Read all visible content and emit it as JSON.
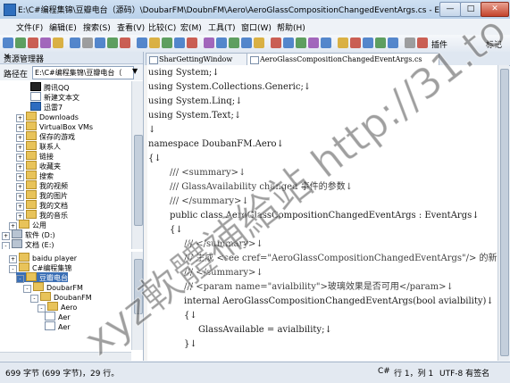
{
  "window": {
    "title": "E:\\C#编程集锦\\豆瓣电台（源码）\\DoubarFM\\DoubnFM\\Aero\\AeroGlassCompositionChangedEventArgs.cs - EmEditor",
    "minimize": "—",
    "maximize": "□",
    "close": "✕"
  },
  "menu": [
    "文件(F)",
    "编辑(E)",
    "搜索(S)",
    "查看(V)",
    "比较(C)",
    "宏(M)",
    "工具(T)",
    "窗口(W)",
    "帮助(H)"
  ],
  "toolbar": {
    "plugin_label": "插件",
    "bookmark_label": "标记",
    "colors": [
      "#2d6cc0",
      "#3a8a3a",
      "#c0392b",
      "#8e44ad",
      "#d4a017",
      "#2d6cc0",
      "#888888",
      "#2d6cc0",
      "#3a8a3a",
      "#c0392b",
      "#2d6cc0",
      "#d4a017",
      "#3a8a3a",
      "#2d6cc0",
      "#c0392b",
      "#8e44ad",
      "#2d6cc0",
      "#3a8a3a",
      "#2d6cc0",
      "#d4a017",
      "#c0392b",
      "#2d6cc0",
      "#3a8a3a",
      "#8e44ad",
      "#2d6cc0",
      "#d4a017",
      "#c0392b",
      "#2d6cc0",
      "#3a8a3a",
      "#2d6cc0",
      "#888888",
      "#c0392b",
      "#2d6cc0",
      "#3a8a3a",
      "#d4a017"
    ]
  },
  "explorer": {
    "title": "资源管理器",
    "close": "✕",
    "path_label": "路径在",
    "path_value": "E:\\C#编程集锦\\豆瓣电台（",
    "tree_top": [
      {
        "label": "腾讯QQ",
        "indent": 4,
        "icon": "qq"
      },
      {
        "label": "新建文本文",
        "indent": 4,
        "icon": "file"
      },
      {
        "label": "迅雷7",
        "indent": 4,
        "icon": "app"
      },
      {
        "label": "Downloads",
        "indent": 2,
        "icon": "folder",
        "pm": "+"
      },
      {
        "label": "VirtualBox VMs",
        "indent": 2,
        "icon": "folder",
        "pm": "+"
      },
      {
        "label": "保存的游戏",
        "indent": 2,
        "icon": "folder",
        "pm": "+"
      },
      {
        "label": "联系人",
        "indent": 2,
        "icon": "folder",
        "pm": "+"
      },
      {
        "label": "链接",
        "indent": 2,
        "icon": "folder",
        "pm": "+"
      },
      {
        "label": "收藏夹",
        "indent": 2,
        "icon": "folder",
        "pm": "+"
      },
      {
        "label": "搜索",
        "indent": 2,
        "icon": "folder",
        "pm": "+"
      },
      {
        "label": "我的视频",
        "indent": 2,
        "icon": "folder",
        "pm": "+"
      },
      {
        "label": "我的图片",
        "indent": 2,
        "icon": "folder",
        "pm": "+"
      },
      {
        "label": "我的文档",
        "indent": 2,
        "icon": "folder",
        "pm": "+"
      },
      {
        "label": "我的音乐",
        "indent": 2,
        "icon": "folder",
        "pm": "+"
      },
      {
        "label": "公用",
        "indent": 1,
        "icon": "folder",
        "pm": "+"
      },
      {
        "label": "软件 (D:)",
        "indent": 0,
        "icon": "drive",
        "pm": "+"
      },
      {
        "label": "文档 (E:)",
        "indent": 0,
        "icon": "drive",
        "pm": "-"
      }
    ],
    "tree_bottom": [
      {
        "label": "baidu player",
        "indent": 1,
        "icon": "folder",
        "pm": "+"
      },
      {
        "label": "C#编程集锦",
        "indent": 1,
        "icon": "folder",
        "pm": "-"
      },
      {
        "label": "豆瓣电台",
        "indent": 2,
        "icon": "folder",
        "pm": "-",
        "selected": true
      },
      {
        "label": "DoubarFM",
        "indent": 3,
        "icon": "folder",
        "pm": "-"
      },
      {
        "label": "DoubanFM",
        "indent": 4,
        "icon": "folder",
        "pm": "-"
      },
      {
        "label": "Aero",
        "indent": 5,
        "icon": "folder",
        "pm": "-"
      },
      {
        "label": "Aer",
        "indent": 6,
        "icon": "file"
      },
      {
        "label": "Aer",
        "indent": 6,
        "icon": "file"
      }
    ]
  },
  "tabs": [
    {
      "label": "SharGettingWindow",
      "active": false
    },
    {
      "label": "AeroGlassCompositionChangedEventArgs.cs",
      "active": true
    }
  ],
  "code": [
    {
      "text": "using System;↓",
      "indent": 0
    },
    {
      "text": "using System.Collections.Generic;↓",
      "indent": 0
    },
    {
      "text": "using System.Linq;↓",
      "indent": 0
    },
    {
      "text": "using System.Text;↓",
      "indent": 0
    },
    {
      "text": "↓",
      "indent": 0
    },
    {
      "text": "namespace DoubanFM.Aero↓",
      "indent": 0
    },
    {
      "text": "{↓",
      "indent": 0
    },
    {
      "text": "/// <summary>↓",
      "indent": 3,
      "comment": true
    },
    {
      "text": "/// GlassAvailability changed 事件的参数↓",
      "indent": 3,
      "comment": true
    },
    {
      "text": "/// </summary>↓",
      "indent": 3,
      "comment": true
    },
    {
      "text": "public class AeroGlassCompositionChangedEventArgs : EventArgs↓",
      "indent": 3
    },
    {
      "text": "{↓",
      "indent": 3
    },
    {
      "text": "/// </summary>↓",
      "indent": 5,
      "comment": true
    },
    {
      "text": "/// 生成 <see cref=\"AeroGlassCompositionChangedEventArgs\"/> 的新↓",
      "indent": 5,
      "comment": true
    },
    {
      "text": "/// </summary>↓",
      "indent": 5,
      "comment": true
    },
    {
      "text": "/// <param name=\"avialbility\">玻璃效果是否可用</param>↓",
      "indent": 5,
      "comment": true
    },
    {
      "text": "internal AeroGlassCompositionChangedEventArgs(bool avialbility)↓",
      "indent": 5
    },
    {
      "text": "{↓",
      "indent": 5
    },
    {
      "text": "GlassAvailable = avialbility;↓",
      "indent": 7
    },
    {
      "text": "}↓",
      "indent": 5
    }
  ],
  "status": {
    "bytes": "699 字节 (699 字节)，29 行。",
    "language": "C#",
    "position": "行 1，列 1",
    "encoding": "UTF-8 有签名"
  },
  "watermark": "xyz軟體補給站 http://31.to"
}
